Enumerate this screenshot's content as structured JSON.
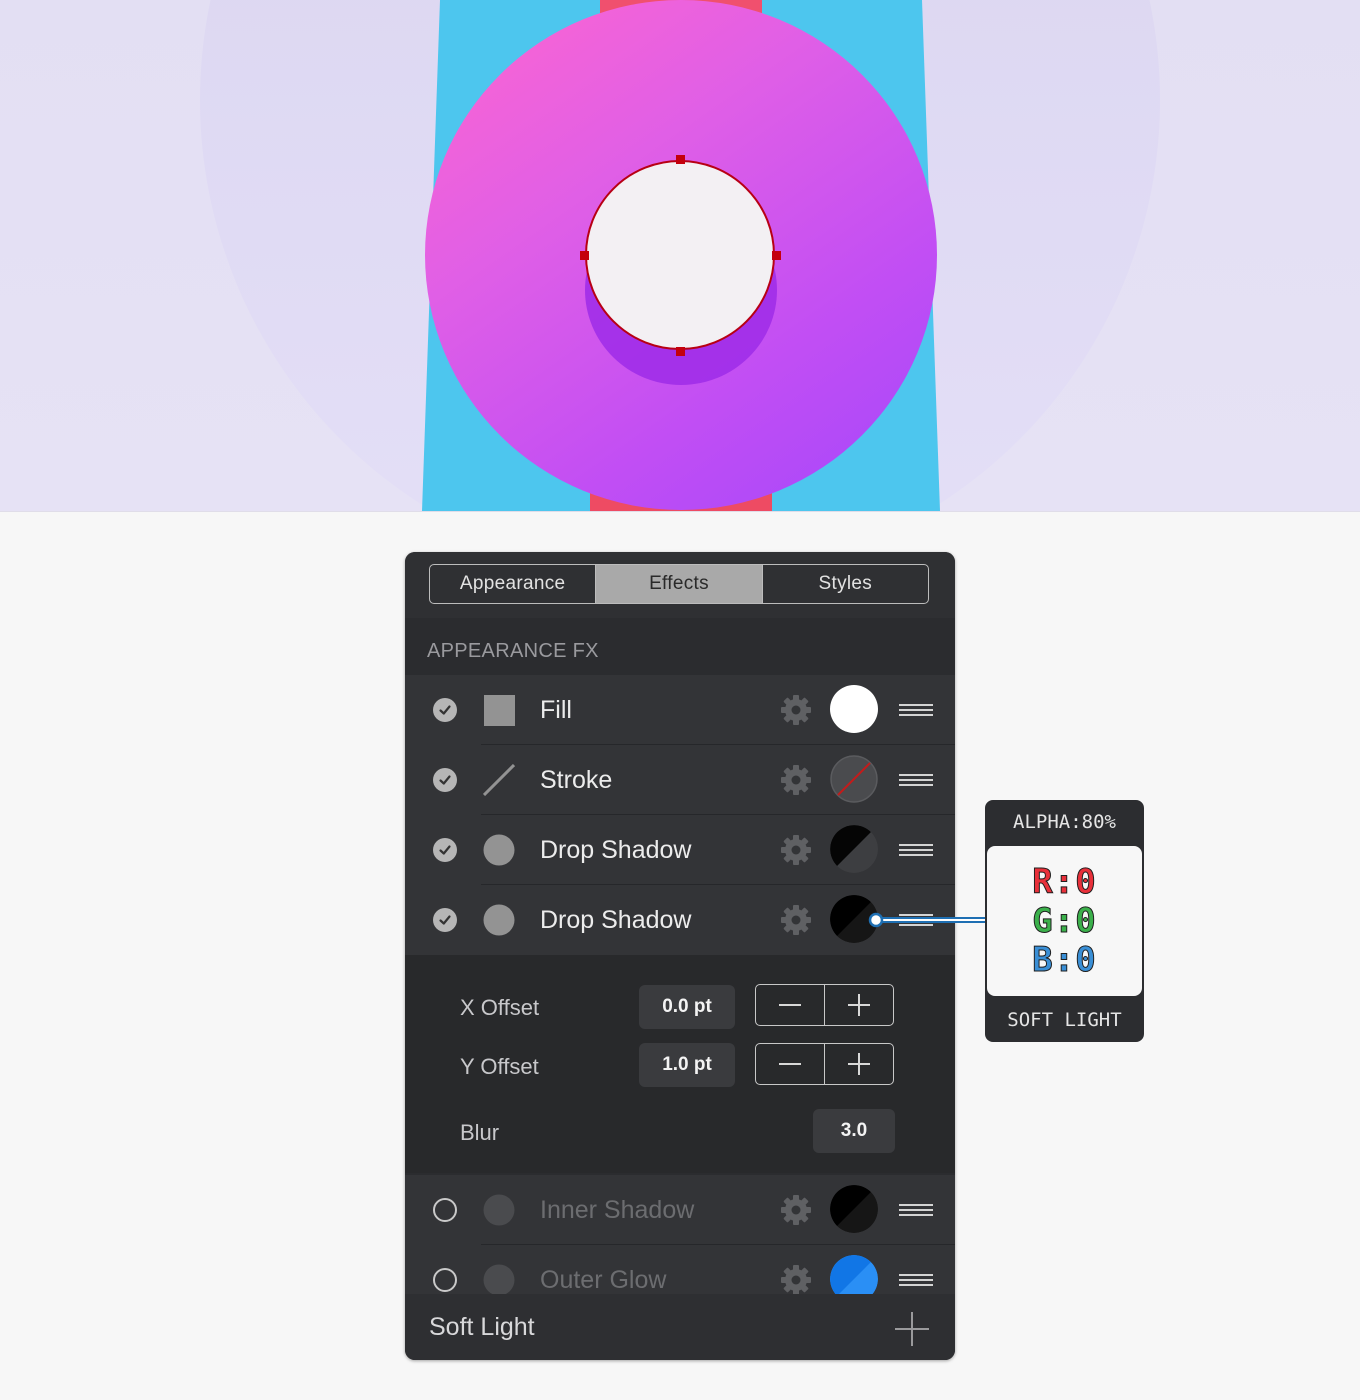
{
  "tabs": [
    "Appearance",
    "Effects",
    "Styles"
  ],
  "active_tab": "Effects",
  "section_title": "APPEARANCE FX",
  "effects": [
    {
      "label": "Fill",
      "enabled": true,
      "icon": "square-icon",
      "swatch": "white"
    },
    {
      "label": "Stroke",
      "enabled": true,
      "icon": "line-icon",
      "swatch": "none"
    },
    {
      "label": "Drop Shadow",
      "enabled": true,
      "icon": "circle-icon",
      "swatch": "black-transparent"
    },
    {
      "label": "Drop Shadow",
      "enabled": true,
      "icon": "circle-icon",
      "swatch": "black"
    },
    {
      "label": "Inner Shadow",
      "enabled": false,
      "icon": "circle-icon",
      "swatch": "black"
    },
    {
      "label": "Outer Glow",
      "enabled": false,
      "icon": "circle-icon",
      "swatch": "blue"
    }
  ],
  "detail": {
    "x_offset_label": "X Offset",
    "x_offset_value": "0.0 pt",
    "y_offset_label": "Y Offset",
    "y_offset_value": "1.0 pt",
    "blur_label": "Blur",
    "blur_value": "3.0",
    "blur_level": 0.1
  },
  "footer_label": "Soft Light",
  "callout": {
    "alpha": "ALPHA:80%",
    "r": "R:0",
    "g": "G:0",
    "b": "B:0",
    "blend": "SOFT LIGHT"
  },
  "colors": {
    "canvas_bg": "#e3dff3",
    "blue_shape": "#4dc6ee",
    "red_bar": "#f0506e",
    "circle_pink": "#ff66cf",
    "circle_purple": "#a347fb",
    "hole_fill": "#f3f0f3",
    "selection": "#c4000c",
    "glow_blue": "#1a82f0"
  }
}
